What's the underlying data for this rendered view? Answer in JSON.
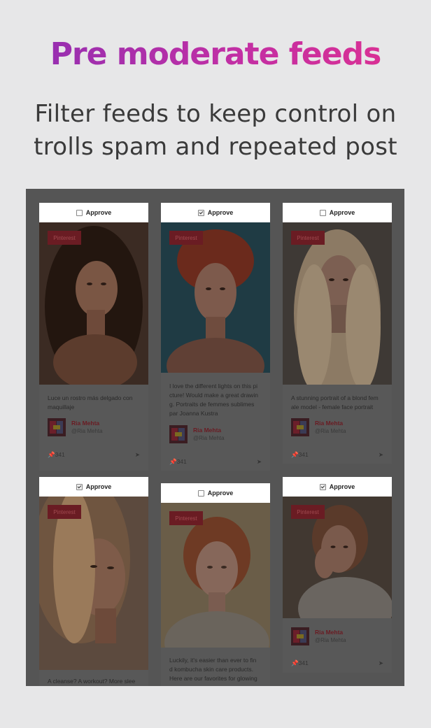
{
  "headline": "Pre moderate feeds",
  "subline": [
    "Filter feeds to keep control on",
    "trolls spam and repeated post"
  ],
  "approve_label": "Approve",
  "source_badge": "Pinterest",
  "author": {
    "name": "Ria Mehta",
    "handle": "@Ria Mehta"
  },
  "pin_count": "341",
  "cards": [
    {
      "approved": false,
      "caption": [
        "Luce un rostro más delgado con",
        "maquillaje"
      ]
    },
    {
      "approved": true,
      "caption": [
        "I love the different lights on this pi",
        "cture! Would make a great drawin",
        "g. Portraits de femmes sublimes",
        "par Joanna Kustra"
      ]
    },
    {
      "approved": false,
      "caption": [
        "A stunning portrait of a blond fem",
        "ale model - female face portrait"
      ]
    },
    {
      "approved": true,
      "caption": [
        "A cleanse? A workout? More slee"
      ]
    },
    {
      "approved": false,
      "caption": [
        "Luckily, it's easier than ever to fin",
        "d kombucha skin care products.",
        "Here are our favorites for glowing"
      ]
    },
    {
      "approved": true,
      "caption": []
    }
  ],
  "colors": {
    "accent_start": "#8d2fb3",
    "accent_end": "#e0308f",
    "badge": "#6a1c23"
  },
  "icons": {
    "pin": "pin-icon",
    "share": "share-icon"
  }
}
